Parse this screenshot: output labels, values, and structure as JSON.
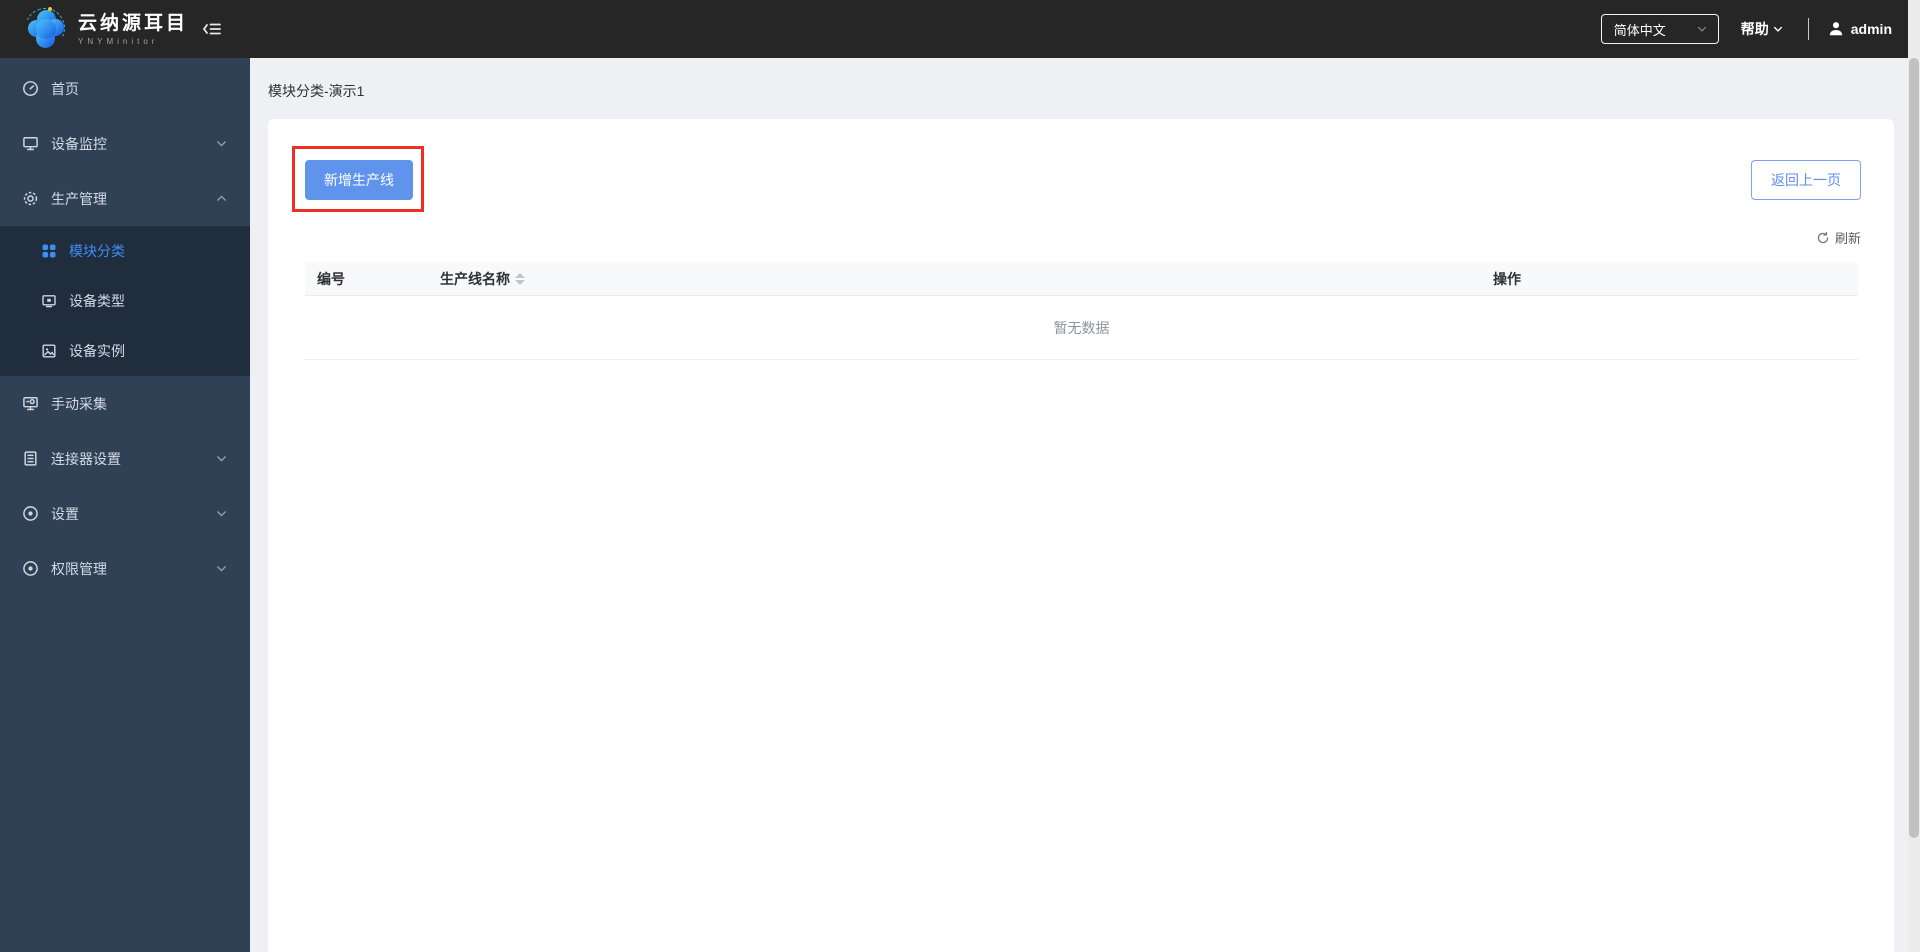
{
  "topbar": {
    "logo_title": "云纳源耳目",
    "logo_subtitle": "YNYMinitor",
    "language_selected": "简体中文",
    "help_label": "帮助",
    "username": "admin"
  },
  "sidebar": {
    "items": [
      {
        "label": "首页",
        "icon": "gauge-icon",
        "chevron": null
      },
      {
        "label": "设备监控",
        "icon": "monitor-icon",
        "chevron": "down"
      },
      {
        "label": "生产管理",
        "icon": "gear-icon",
        "chevron": "up",
        "expanded": true
      },
      {
        "label": "手动采集",
        "icon": "manual-collect-icon",
        "chevron": null
      },
      {
        "label": "连接器设置",
        "icon": "connector-icon",
        "chevron": "down"
      },
      {
        "label": "设置",
        "icon": "settings-icon",
        "chevron": "down"
      },
      {
        "label": "权限管理",
        "icon": "permissions-icon",
        "chevron": "down"
      }
    ],
    "submenu": [
      {
        "label": "模块分类",
        "icon": "four-squares-icon",
        "active": true
      },
      {
        "label": "设备类型",
        "icon": "device-type-icon",
        "active": false
      },
      {
        "label": "设备实例",
        "icon": "device-instance-icon",
        "active": false
      }
    ]
  },
  "main": {
    "page_title": "模块分类-演示1",
    "add_button_label": "新增生产线",
    "back_button_label": "返回上一页",
    "refresh_label": "刷新",
    "table": {
      "columns": [
        "编号",
        "生产线名称",
        "操作"
      ],
      "rows": [],
      "empty_text": "暂无数据"
    }
  },
  "colors": {
    "topbar_bg": "#262626",
    "sidebar_bg": "#304156",
    "submenu_bg": "#1f2d3d",
    "active_menu_text": "#3f8cf5",
    "primary_button_bg": "#6094ec",
    "secondary_button_border": "#7ba3f2",
    "annotation_red": "#ee2f23",
    "content_bg": "#eef0f4"
  }
}
